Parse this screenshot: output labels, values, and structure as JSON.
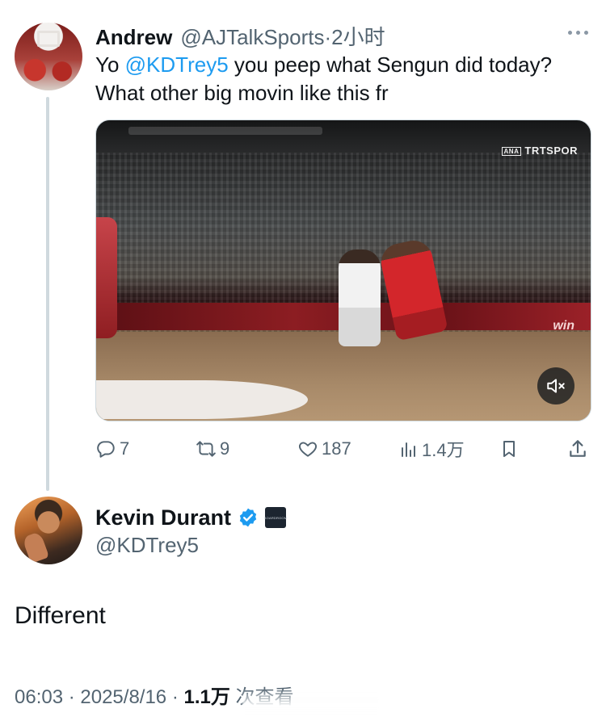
{
  "original_tweet": {
    "author_name": "Andrew",
    "handle": "@AJTalkSports",
    "time": "·2小时",
    "text_prefix": "Yo ",
    "mention": "@KDTrey5",
    "text_rest": " you peep what Sengun did today? What other big movin like this fr",
    "media": {
      "watermark": "TRTSPOR",
      "watermark_badge": "ANA",
      "adboard_text": "win"
    },
    "actions": {
      "replies": "7",
      "reposts": "9",
      "likes": "187",
      "views": "1.4万"
    }
  },
  "reply_tweet": {
    "author_name": "Kevin Durant",
    "handle": "@KDTrey5",
    "affiliate_label": "BOARDROOM",
    "text": "Different",
    "timestamp": "06:03 · 2025/8/16 · ",
    "views_count": "1.1万",
    "views_suffix": " 次查看"
  },
  "colors": {
    "accent": "#1d9bf0",
    "text_primary": "#0f1419",
    "text_secondary": "#536471",
    "thread_line": "#cfd9de"
  },
  "icons": [
    "reply-icon",
    "repost-icon",
    "like-icon",
    "views-icon",
    "bookmark-icon",
    "share-icon",
    "verified-badge-icon",
    "mute-icon",
    "more-icon"
  ]
}
